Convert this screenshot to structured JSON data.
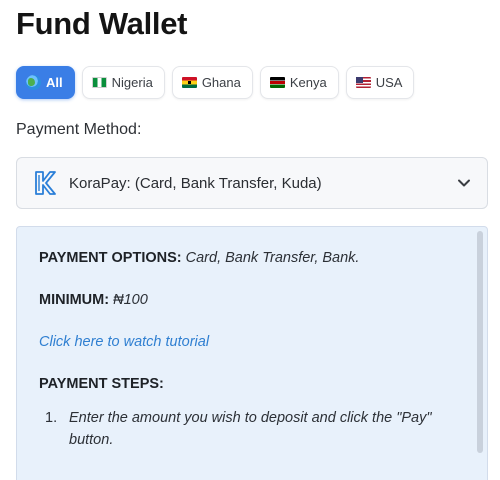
{
  "page": {
    "title": "Fund Wallet"
  },
  "tabs": [
    {
      "label": "All",
      "icon": "globe-icon",
      "active": true
    },
    {
      "label": "Nigeria",
      "icon": "nigeria-flag-icon",
      "active": false
    },
    {
      "label": "Ghana",
      "icon": "ghana-flag-icon",
      "active": false
    },
    {
      "label": "Kenya",
      "icon": "kenya-flag-icon",
      "active": false
    },
    {
      "label": "USA",
      "icon": "usa-flag-icon",
      "active": false
    }
  ],
  "payment_method": {
    "label": "Payment Method:",
    "selected": "KoraPay: (Card, Bank Transfer, Kuda)",
    "icon": "korapay-logo-icon"
  },
  "details": {
    "options_label": "PAYMENT OPTIONS:",
    "options_value": "Card, Bank Transfer, Bank.",
    "minimum_label": "MINIMUM:",
    "minimum_value": "₦100",
    "tutorial_link": "Click here to watch tutorial",
    "steps_label": "PAYMENT STEPS:",
    "steps": [
      {
        "num": "1.",
        "text": "Enter the amount you wish to deposit and click the \"Pay\" button."
      }
    ]
  },
  "colors": {
    "accent": "#3a7ee6",
    "panel_bg": "#e8f1fb",
    "link": "#2f7fd1"
  }
}
